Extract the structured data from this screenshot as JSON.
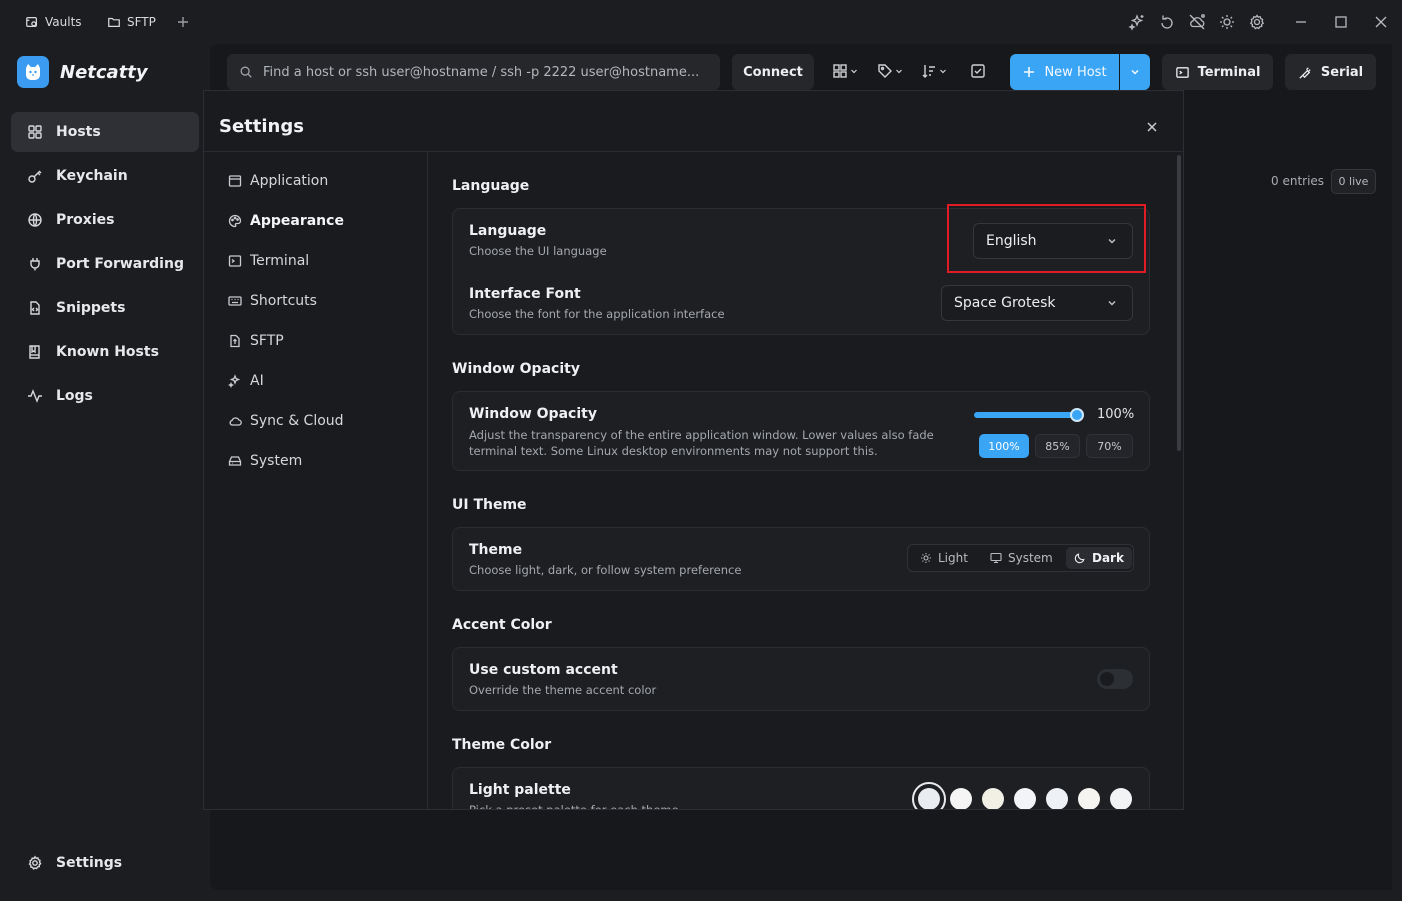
{
  "titlebar": {
    "tabs": [
      {
        "label": "Vaults",
        "icon": "vault-icon"
      },
      {
        "label": "SFTP",
        "icon": "folder-icon"
      }
    ],
    "add_tab_icon": "plus-icon",
    "right_icons": [
      "sparkles-icon",
      "refresh-icon",
      "cloud-off-icon",
      "sun-icon",
      "gear-icon"
    ],
    "window_controls": [
      "minimize-icon",
      "maximize-icon",
      "close-icon"
    ]
  },
  "brand": {
    "name": "Netcatty"
  },
  "sidebar": {
    "items": [
      {
        "label": "Hosts",
        "icon": "grid-icon",
        "active": true
      },
      {
        "label": "Keychain",
        "icon": "key-icon"
      },
      {
        "label": "Proxies",
        "icon": "globe-icon"
      },
      {
        "label": "Port Forwarding",
        "icon": "plug-icon"
      },
      {
        "label": "Snippets",
        "icon": "file-code-icon"
      },
      {
        "label": "Known Hosts",
        "icon": "book-icon"
      },
      {
        "label": "Logs",
        "icon": "activity-icon"
      }
    ],
    "footer_label": "Settings"
  },
  "toolbar": {
    "search_placeholder": "Find a host or ssh user@hostname / ssh -p 2222 user@hostname...",
    "connect_label": "Connect",
    "new_host_label": "New Host",
    "terminal_label": "Terminal",
    "serial_label": "Serial"
  },
  "hosts_panel": {
    "entries_label": "0 entries",
    "live_label": "0 live"
  },
  "settings": {
    "title": "Settings",
    "nav": [
      {
        "label": "Application",
        "icon": "window-icon"
      },
      {
        "label": "Appearance",
        "icon": "palette-icon",
        "active": true
      },
      {
        "label": "Terminal",
        "icon": "terminal-icon"
      },
      {
        "label": "Shortcuts",
        "icon": "keyboard-icon"
      },
      {
        "label": "SFTP",
        "icon": "file-transfer-icon"
      },
      {
        "label": "AI",
        "icon": "sparkles-icon"
      },
      {
        "label": "Sync & Cloud",
        "icon": "cloud-icon"
      },
      {
        "label": "System",
        "icon": "hard-drive-icon"
      }
    ],
    "sections": {
      "language": {
        "title": "Language",
        "language_row": {
          "title": "Language",
          "desc": "Choose the UI language",
          "value": "English"
        },
        "font_row": {
          "title": "Interface Font",
          "desc": "Choose the font for the application interface",
          "value": "Space Grotesk"
        }
      },
      "opacity": {
        "title": "Window Opacity",
        "row_title": "Window Opacity",
        "desc_line1": "Adjust the transparency of the entire application window. Lower values also fade",
        "desc_line2": "terminal text. Some Linux desktop environments may not support this.",
        "value": "100%",
        "level": 1.0,
        "presets": [
          "100%",
          "85%",
          "70%"
        ]
      },
      "theme": {
        "title": "UI Theme",
        "row_title": "Theme",
        "desc": "Choose light, dark, or follow system preference",
        "options": [
          "Light",
          "System",
          "Dark"
        ],
        "selected": "Dark"
      },
      "accent": {
        "title": "Accent Color",
        "row_title": "Use custom accent",
        "desc": "Override the theme accent color",
        "enabled": false
      },
      "theme_color": {
        "title": "Theme Color",
        "row_title": "Light palette",
        "desc": "Pick a preset palette for each theme",
        "swatches": [
          "#e9ecf0",
          "#f5f5f5",
          "#f2efe4",
          "#f3f4f7",
          "#eef1f6",
          "#f6f4f1",
          "#f1f3f5"
        ]
      }
    }
  },
  "colors": {
    "accent": "#3ba5f5",
    "highlight": "#e01b24"
  }
}
